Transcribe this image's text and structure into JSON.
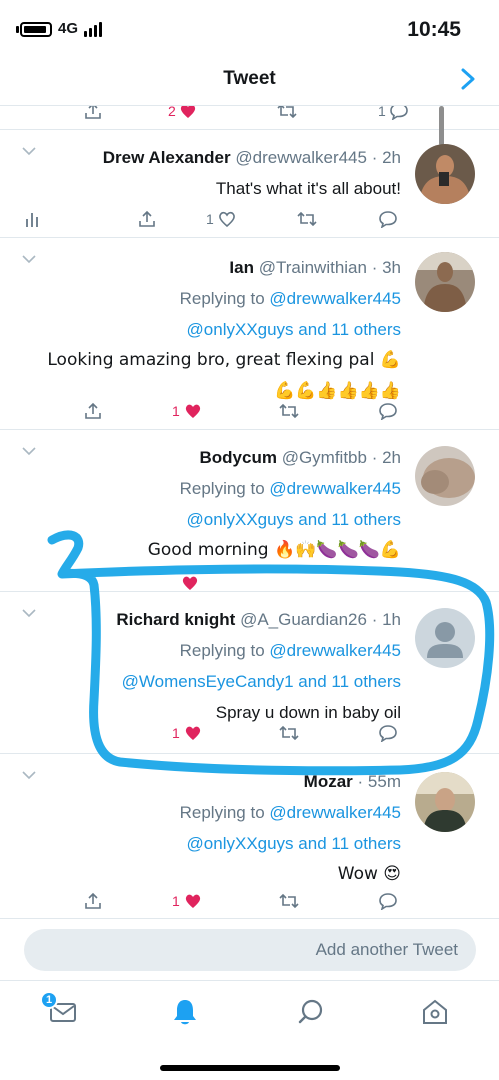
{
  "status_bar": {
    "time": "10:45",
    "network": "4G"
  },
  "header": {
    "title": "Tweet"
  },
  "top_partial": {
    "reply_count": "1",
    "like_count": "2"
  },
  "tweets": [
    {
      "name": "Drew Alexander",
      "handle": "@drewwalker445",
      "time": "2h",
      "text": "That's what it's all about!",
      "reply_count": "",
      "retweet_count": "",
      "like_count": "1",
      "liked": false
    },
    {
      "name": "Ian",
      "handle": "@Trainwithian",
      "time": "3h",
      "replying_prefix": "Replying to",
      "replying_to": "@drewwalker445",
      "replying_others": "@onlyXXguys and 11 others",
      "text": "Looking amazing bro, great flexing pal 💪",
      "text2": "💪💪👍👍👍👍",
      "like_count": "1",
      "liked": true
    },
    {
      "name": "Bodycum",
      "handle": "@Gymfitbb",
      "time": "2h",
      "replying_prefix": "Replying to",
      "replying_to": "@drewwalker445",
      "replying_others": "@onlyXXguys and 11 others",
      "text": "Good morning 🔥🙌🍆🍆🍆💪",
      "liked": true
    },
    {
      "name": "Richard knight",
      "handle": "@A_Guardian26",
      "time": "1h",
      "replying_prefix": "Replying to",
      "replying_to": "@drewwalker445",
      "replying_others": "@WomensEyeCandy1 and 11 others",
      "text": "Spray u down in baby oil",
      "like_count": "1",
      "liked": true
    },
    {
      "name": "Mozar",
      "handle": "",
      "time": "55m",
      "replying_prefix": "Replying to",
      "replying_to": "@drewwalker445",
      "replying_others": "@onlyXXguys and 11 others",
      "text": "Wow 😍",
      "like_count": "1",
      "liked": true
    }
  ],
  "compose": {
    "placeholder": "Add another Tweet"
  },
  "tabbar": {
    "messages_badge": "1"
  },
  "colors": {
    "accent": "#1da1f2",
    "like": "#e0245e",
    "scribble": "#1aa7e8",
    "secondary_text": "#657786"
  }
}
